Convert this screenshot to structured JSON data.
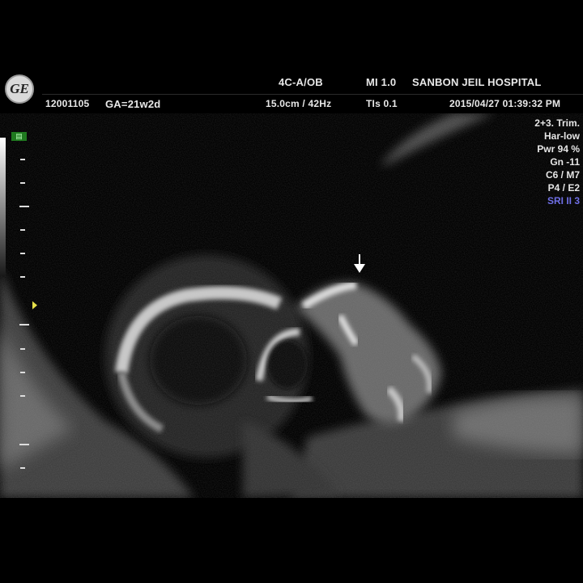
{
  "header": {
    "logo": "GE",
    "probe_preset": "4C-A/OB",
    "mi": "MI  1.0",
    "hospital": "SANBON JEIL HOSPITAL",
    "patient_id": "12001105",
    "ga": "GA=21w2d",
    "depth_freq": "15.0cm / 42Hz",
    "tis": "TIs  0.1",
    "datetime": "2015/04/27  01:39:32 PM"
  },
  "params": {
    "trim": "2+3. Trim.",
    "har": "Har-low",
    "pwr": "Pwr  94 %",
    "gn": "Gn  -11",
    "c_m": "C6 / M7",
    "p_e": "P4 / E2",
    "sri": "SRI II 3"
  },
  "colors": {
    "text": "#e8e8e8",
    "sri_blue": "#6f6fe6",
    "focus_marker": "#e6e04a",
    "badge_green": "#1f7a1f"
  },
  "icons": [
    "ge-logo",
    "arrow-down-annotation",
    "focus-marker-triangle"
  ]
}
